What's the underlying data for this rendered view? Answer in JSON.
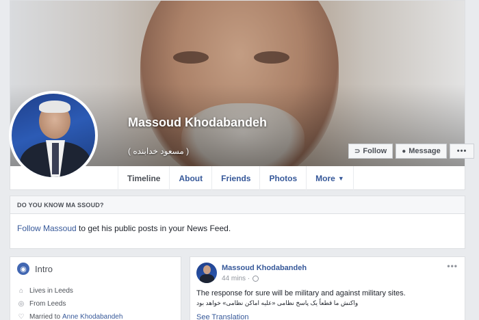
{
  "profile": {
    "name": "Massoud Khodabandeh",
    "alt_name": "( مسعود خدابنده )"
  },
  "actions": {
    "follow_label": "Follow",
    "follow_icon": "rss-icon",
    "message_label": "Message",
    "message_icon": "messenger-icon",
    "more_label": "•••"
  },
  "tabs": [
    {
      "label": "Timeline"
    },
    {
      "label": "About"
    },
    {
      "label": "Friends"
    },
    {
      "label": "Photos"
    },
    {
      "label": "More"
    }
  ],
  "know": {
    "title": "DO YOU KNOW MA SSOUD?",
    "link_text": "Follow Massoud",
    "text": "to get his public posts in your News Feed."
  },
  "intro": {
    "title": "Intro",
    "items": [
      {
        "icon": "home-icon",
        "text": "Lives in Leeds",
        "link": ""
      },
      {
        "icon": "location-icon",
        "text": "From Leeds",
        "link": ""
      },
      {
        "icon": "heart-icon",
        "text": "Married to",
        "link": "Anne Khodabandeh"
      }
    ]
  },
  "post": {
    "author": "Massoud Khodabandeh",
    "time": "44 mins ·",
    "text": "The response for sure will be military and against military sites.",
    "text_fa": "واکنش ما قطعاً یک پاسخ نظامی «علیه اماکن نظامی» خواهد بود",
    "translation_link": "See Translation",
    "menu": "•••"
  },
  "colors": {
    "link": "#365899",
    "background": "#e9ebee",
    "accent": "#4267b2"
  }
}
